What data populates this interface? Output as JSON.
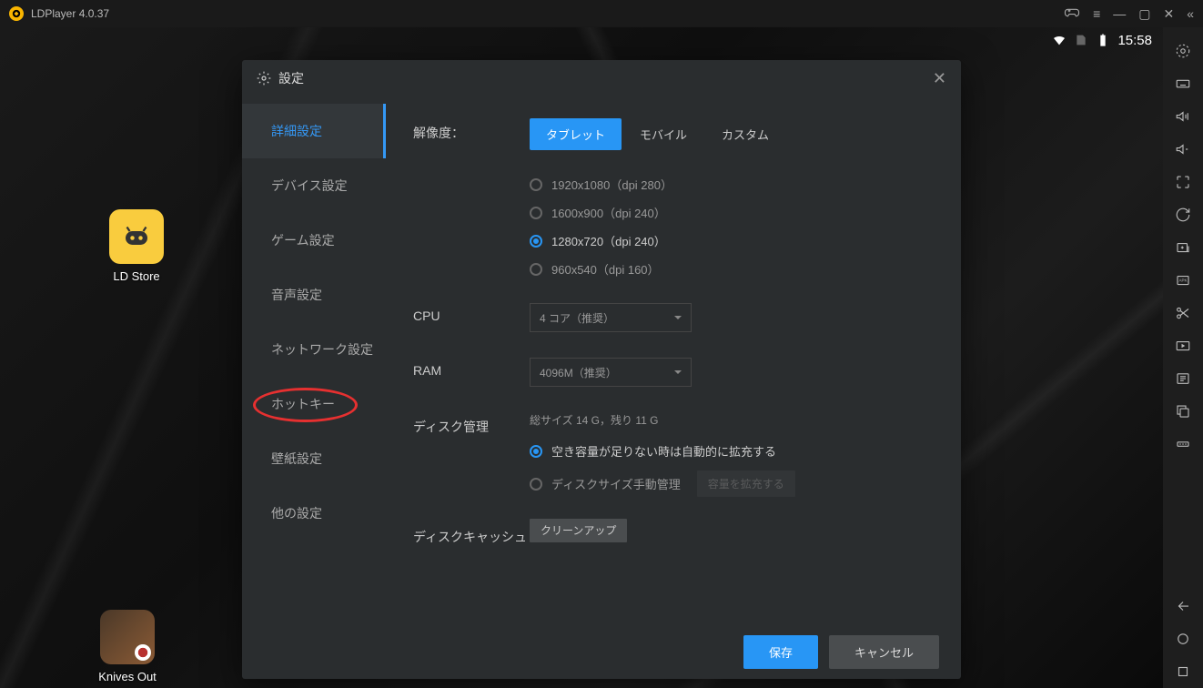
{
  "titlebar": {
    "app_title": "LDPlayer 4.0.37"
  },
  "android_status": {
    "time": "15:58"
  },
  "desktop_icons": {
    "ldstore": "LD Store",
    "knives": "Knives Out"
  },
  "dialog": {
    "title": "設定",
    "tabs": {
      "advanced": "詳細設定",
      "device": "デバイス設定",
      "game": "ゲーム設定",
      "audio": "音声設定",
      "network": "ネットワーク設定",
      "hotkey": "ホットキー",
      "wallpaper": "壁紙設定",
      "other": "他の設定"
    },
    "settings": {
      "resolution_label": "解像度：",
      "resolution_modes": {
        "tablet": "タブレット",
        "mobile": "モバイル",
        "custom": "カスタム"
      },
      "resolution_options": {
        "r1": "1920x1080（dpi 280）",
        "r2": "1600x900（dpi 240）",
        "r3": "1280x720（dpi 240）",
        "r4": "960x540（dpi 160）"
      },
      "cpu_label": "CPU",
      "cpu_value": "4 コア（推奨）",
      "ram_label": "RAM",
      "ram_value": "4096M（推奨）",
      "disk_label": "ディスク管理",
      "disk_info": "総サイズ 14 G，残り 11 G",
      "disk_auto": "空き容量が足りない時は自動的に拡充する",
      "disk_manual": "ディスクサイズ手動管理",
      "disk_expand_btn": "容量を拡充する",
      "cache_label": "ディスクキャッシュ",
      "cache_btn": "クリーンアップ"
    },
    "footer": {
      "save": "保存",
      "cancel": "キャンセル"
    }
  }
}
